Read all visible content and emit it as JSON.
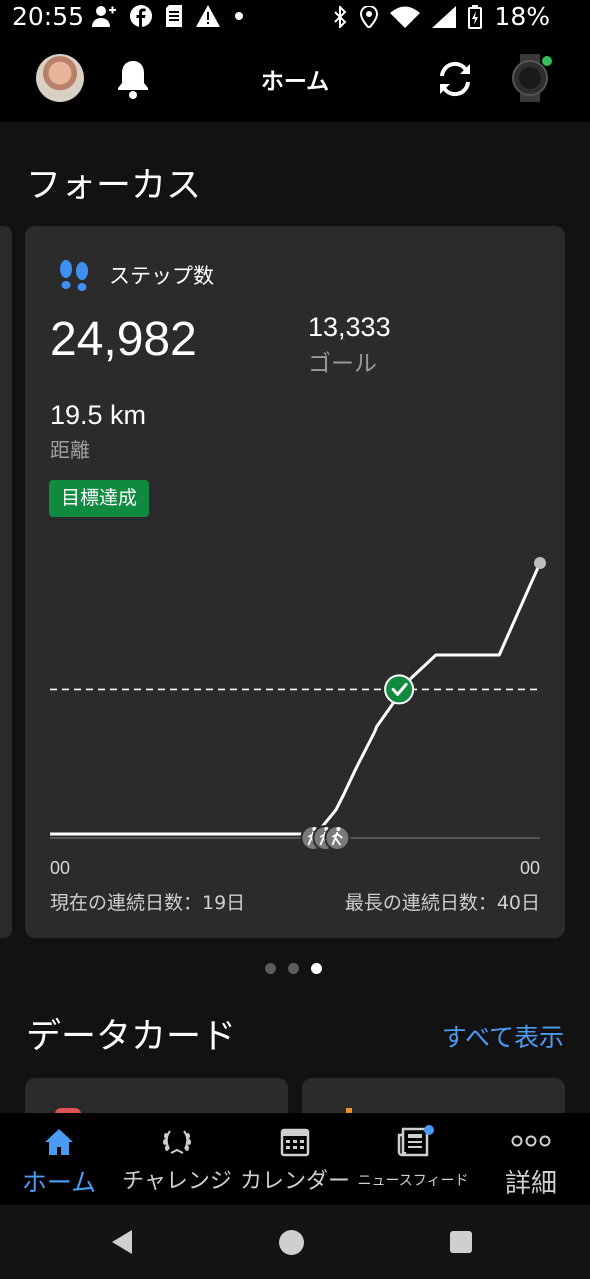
{
  "status_bar": {
    "time": "20:55",
    "battery": "18%",
    "icons": [
      "person-add-icon",
      "facebook-icon",
      "sim-icon",
      "warning-icon",
      "dot-icon",
      "bluetooth-icon",
      "location-icon",
      "wifi-icon",
      "signal-icon",
      "battery-charging-icon"
    ]
  },
  "app_bar": {
    "title": "ホーム",
    "icons": [
      "avatar",
      "bell-icon",
      "sync-icon",
      "watch-icon"
    ]
  },
  "focus": {
    "section_title": "フォーカス",
    "card": {
      "label": "ステップ数",
      "steps": "24,982",
      "goal_value": "13,333",
      "goal_label": "ゴール",
      "distance_value": "19.5 km",
      "distance_label": "距離",
      "badge": "目標達成",
      "axis_start": "00",
      "axis_end": "00",
      "streak_current": "現在の連続日数：19日",
      "streak_longest": "最長の連続日数：40日"
    },
    "pager": {
      "count": 3,
      "active_index": 2
    }
  },
  "chart_data": {
    "type": "line",
    "x_unit": "hour of day",
    "x": [
      0,
      12.9,
      13.1,
      13.3,
      14.0,
      14.4,
      14.9,
      15.0,
      15.9,
      16.0,
      16.9,
      17.1,
      18.9,
      22.0,
      24.0
    ],
    "y": [
      0,
      0,
      300,
      600,
      2200,
      3700,
      5700,
      6100,
      9400,
      9900,
      12300,
      13333,
      16500,
      16500,
      24982
    ],
    "goal": 13333,
    "goal_reached_marker": true,
    "activity_markers": [
      "walking-icon",
      "walking-icon",
      "walking-icon"
    ],
    "ylim": [
      0,
      26000
    ],
    "xlim": [
      0,
      24
    ]
  },
  "data_cards": {
    "section_title": "データカード",
    "show_all": "すべて表示"
  },
  "bottom_nav": {
    "items": [
      {
        "label": "ホーム",
        "icon": "home-icon"
      },
      {
        "label": "チャレンジ",
        "icon": "laurel-icon"
      },
      {
        "label": "カレンダー",
        "icon": "calendar-icon"
      },
      {
        "label": "ニュースフィード",
        "icon": "news-icon"
      },
      {
        "label": "詳細",
        "icon": "more-icon"
      }
    ]
  },
  "colors": {
    "accent": "#4b9bf2",
    "goal_green": "#0f8a3f",
    "card_bg": "#2b2b2b",
    "page_bg": "#121212"
  }
}
